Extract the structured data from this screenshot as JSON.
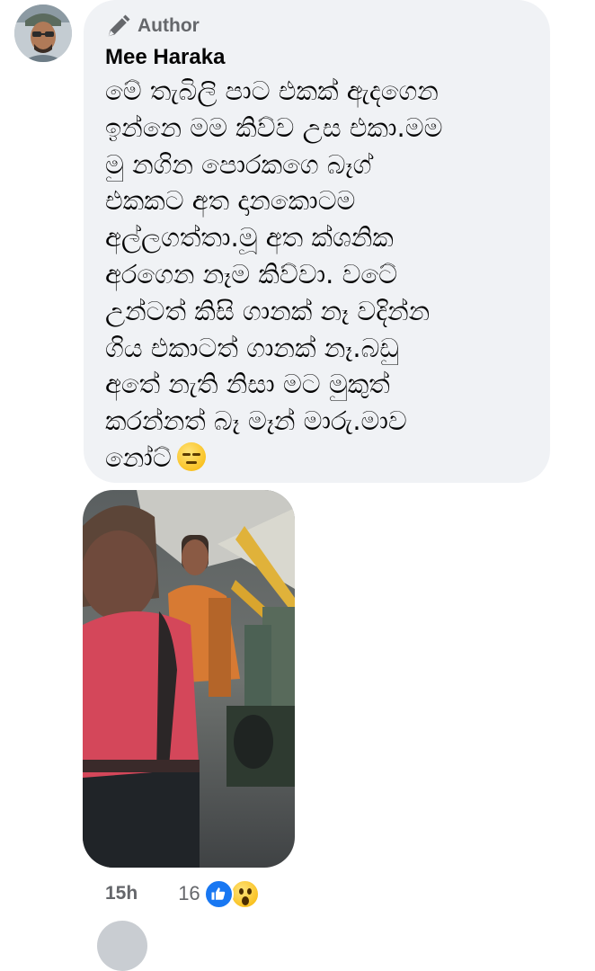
{
  "comment": {
    "badge": {
      "icon": "pen-icon",
      "label": "Author"
    },
    "author_name": "Mee Haraka",
    "message_lines": [
      "මේ තැබිලි පාට එකක් ඇදගෙන",
      "ඉන්නෙ මම කිව්ව උස එකා.මම",
      "මු නගින පොරකගෙ බෑග්",
      "එකකට අත දානකොටම",
      "අල්ලගත්තා.මූ අත ක්ශනික",
      "අරගෙන නෑම කිව්වා. වටේ",
      "උන්ටත් කිසි ගානක් නෑ වදින්න",
      "ගිය එකාටත් ගානක් නෑ.බඩු",
      "අතේ නැති නිසා මට මුකුත්",
      "කරන්නත් බෑ මෑන් මාරු.මාව",
      "නෝට්"
    ],
    "trailing_emoji": "expressionless-face-emoji",
    "attachment": {
      "type": "photo",
      "description_icon": "photo-attachment"
    },
    "timestamp": "15h",
    "reaction_count": "16",
    "reactions": [
      "like-icon",
      "wow-icon"
    ],
    "colors": {
      "bubble": "#f0f2f5",
      "text": "#050505",
      "secondary": "#65676b",
      "like": "#1877f2"
    }
  }
}
